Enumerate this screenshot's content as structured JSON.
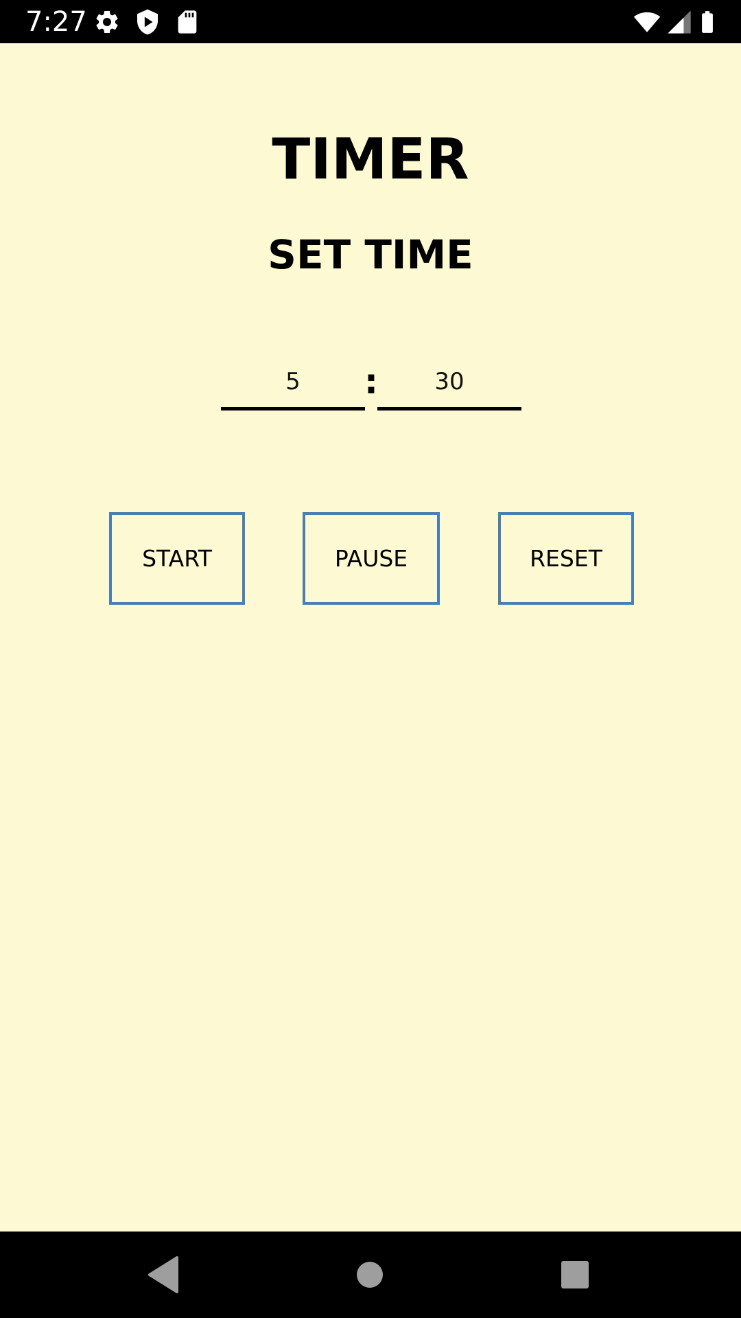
{
  "status_bar": {
    "time": "7:27",
    "icons": [
      "settings-icon",
      "shield-play-icon",
      "sd-card-icon",
      "wifi-icon",
      "signal-icon",
      "battery-icon"
    ]
  },
  "app": {
    "title": "TIMER",
    "subtitle": "SET TIME",
    "minutes_value": "5",
    "seconds_value": "30",
    "separator": ":",
    "buttons": {
      "start": "START",
      "pause": "PAUSE",
      "reset": "RESET"
    }
  },
  "nav_bar": {
    "icons": [
      "back-icon",
      "home-icon",
      "recents-icon"
    ]
  },
  "colors": {
    "background": "#fdf9d2",
    "button_border": "#4a7fb0",
    "system_bars": "#000000",
    "nav_icons": "#9e9e9e"
  }
}
